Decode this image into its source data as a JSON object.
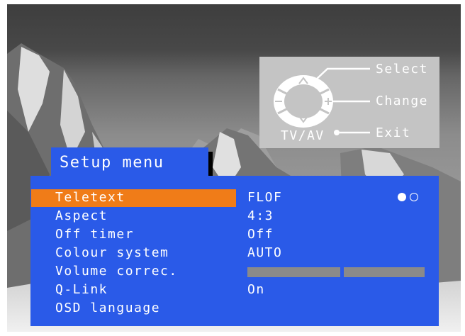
{
  "remote_hint": {
    "select_label": "Select",
    "change_label": "Change",
    "exit_label": "Exit",
    "tvav_label": "TV/AV"
  },
  "setup_menu": {
    "title": "Setup menu",
    "rows": [
      {
        "label": "Teletext",
        "value": "FLOF",
        "selected": true
      },
      {
        "label": "Aspect",
        "value": "4:3"
      },
      {
        "label": "Off timer",
        "value": "Off"
      },
      {
        "label": "Colour system",
        "value": "AUTO"
      },
      {
        "label": "Volume correc.",
        "value": ""
      },
      {
        "label": "Q-Link",
        "value": "On"
      },
      {
        "label": "OSD language",
        "value": ""
      }
    ],
    "teletext_indicator": [
      "filled",
      "hollow"
    ]
  },
  "colors": {
    "menu_blue": "#2a5ae8",
    "highlight_orange": "#f07c18",
    "panel_gray": "#c4c4c4"
  }
}
